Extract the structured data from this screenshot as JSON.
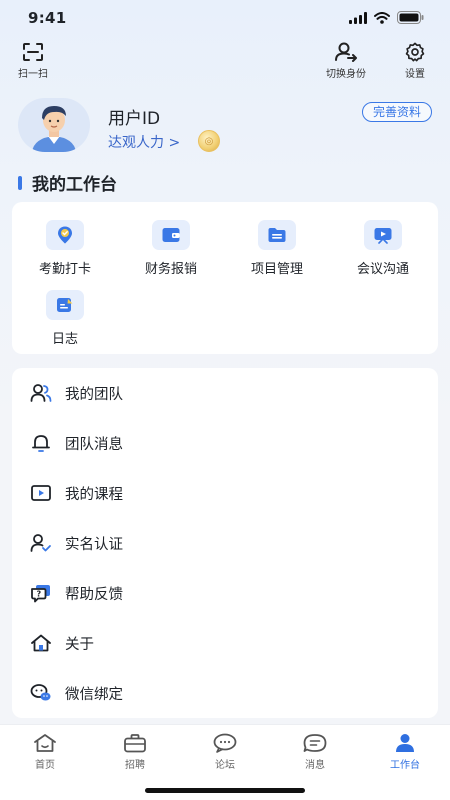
{
  "status_bar": {
    "time": "9:41"
  },
  "topbar": {
    "scan_label": "扫一扫",
    "switch_label": "切换身份",
    "settings_label": "设置"
  },
  "profile": {
    "username": "用户ID",
    "company": "达观人力 >",
    "complete_button": "完善资料"
  },
  "section": {
    "title": "我的工作台"
  },
  "workbench": {
    "items": [
      {
        "label": "考勤打卡",
        "icon": "location-check-icon"
      },
      {
        "label": "财务报销",
        "icon": "wallet-icon"
      },
      {
        "label": "项目管理",
        "icon": "folder-icon"
      },
      {
        "label": "会议沟通",
        "icon": "video-icon"
      },
      {
        "label": "日志",
        "icon": "edit-note-icon"
      }
    ]
  },
  "menu": {
    "items": [
      {
        "label": "我的团队",
        "icon": "team-icon"
      },
      {
        "label": "团队消息",
        "icon": "bell-icon"
      },
      {
        "label": "我的课程",
        "icon": "course-play-icon"
      },
      {
        "label": "实名认证",
        "icon": "user-verified-icon"
      },
      {
        "label": "帮助反馈",
        "icon": "help-feedback-icon"
      },
      {
        "label": "关于",
        "icon": "house-icon"
      },
      {
        "label": "微信绑定",
        "icon": "wechat-icon"
      }
    ]
  },
  "tabbar": {
    "tabs": [
      {
        "label": "首页",
        "icon": "home-icon"
      },
      {
        "label": "招聘",
        "icon": "briefcase-icon"
      },
      {
        "label": "论坛",
        "icon": "forum-icon"
      },
      {
        "label": "消息",
        "icon": "message-icon"
      },
      {
        "label": "工作台",
        "icon": "person-icon",
        "active": true
      }
    ]
  },
  "colors": {
    "accent": "#3a78e6",
    "active_tab": "#2f6fe0",
    "background": "#eef3fa"
  }
}
